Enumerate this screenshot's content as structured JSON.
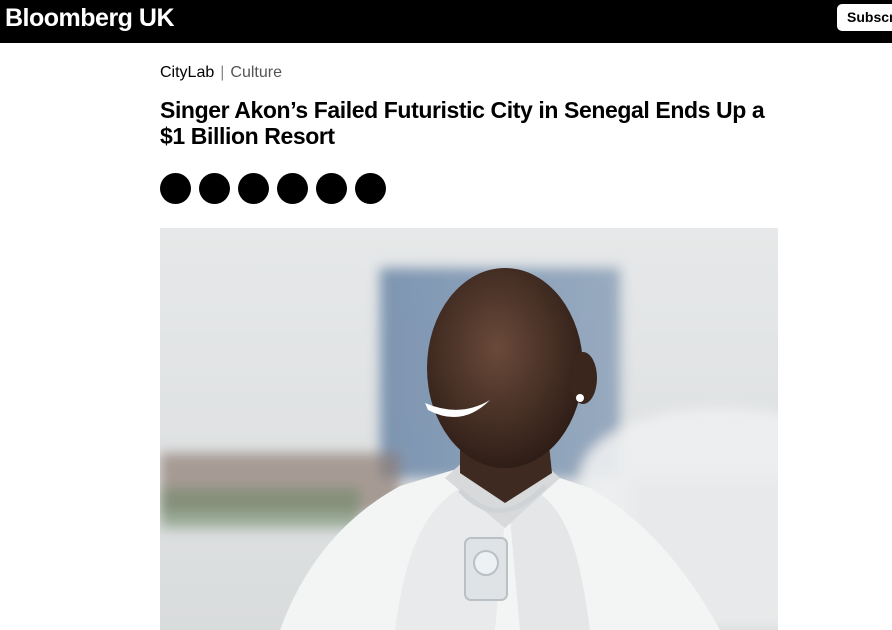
{
  "header": {
    "brand": "Bloomberg UK",
    "subscribe_label": "Subscribe"
  },
  "breadcrumb": {
    "section": "CityLab",
    "separator": "|",
    "subsection": "Culture"
  },
  "article": {
    "headline": "Singer Akon’s Failed Futuristic City in Senegal Ends Up a $1 Billion Resort"
  },
  "share": {
    "buttons": [
      "share-1",
      "share-2",
      "share-3",
      "share-4",
      "share-5",
      "share-6"
    ]
  },
  "hero": {
    "icon": "portrait-photo"
  }
}
